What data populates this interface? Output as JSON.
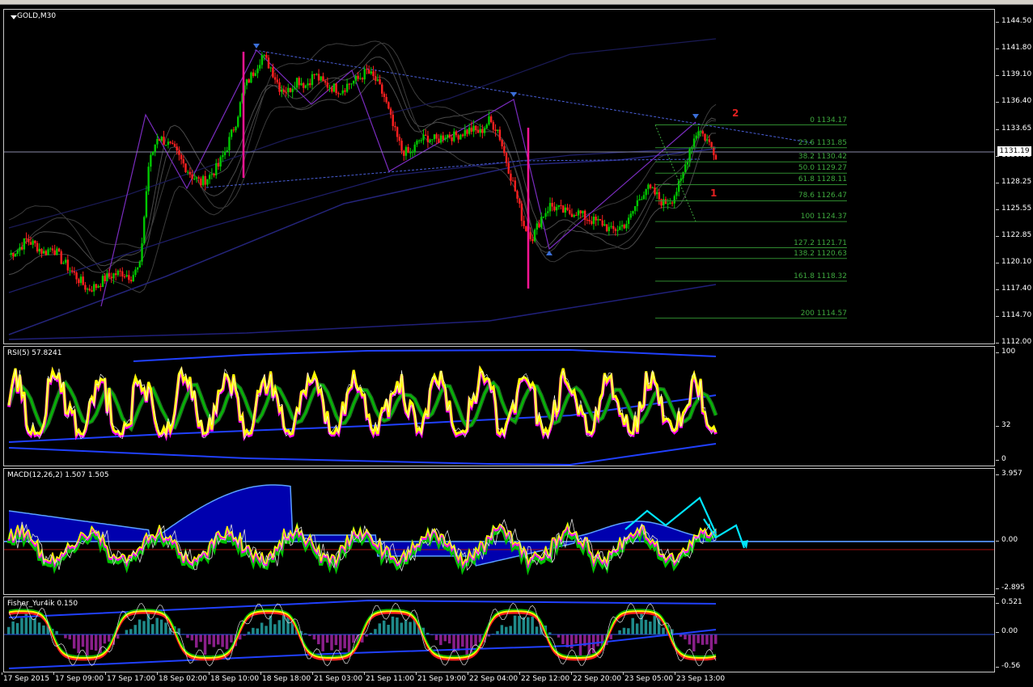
{
  "window": {
    "symbol_label": "GOLD,M30",
    "current_price": "1131.19"
  },
  "colors": {
    "bull_candle": "#00c800",
    "bear_candle": "#ff2020",
    "grid_line": "#c8c8c8",
    "rsi_main": "#ffff00",
    "rsi_shadow": "#ff00ff",
    "signal_green": "#00c000",
    "band_blue": "#2040ff",
    "macd_hist": "#0000cc",
    "arrow_cyan": "#00e5ff",
    "fib_text": "#3ea83e",
    "wave_label": "#e02020"
  },
  "price_scale": [
    "1144.50",
    "1141.80",
    "1139.10",
    "1136.40",
    "1133.65",
    "1130.95",
    "1128.25",
    "1125.55",
    "1122.85",
    "1120.10",
    "1117.40",
    "1114.70",
    "1112.00"
  ],
  "fibonacci": [
    {
      "label": "0  1134.17",
      "price": 1134.17
    },
    {
      "label": "23.6  1131.85",
      "price": 1131.85
    },
    {
      "label": "38.2  1130.42",
      "price": 1130.42
    },
    {
      "label": "50.0  1129.27",
      "price": 1129.27
    },
    {
      "label": "61.8  1128.11",
      "price": 1128.11
    },
    {
      "label": "78.6  1126.47",
      "price": 1126.47
    },
    {
      "label": "100  1124.37",
      "price": 1124.37
    },
    {
      "label": "127.2  1121.71",
      "price": 1121.71
    },
    {
      "label": "138.2  1120.63",
      "price": 1120.63
    },
    {
      "label": "161.8  1118.32",
      "price": 1118.32
    },
    {
      "label": "200  1114.57",
      "price": 1114.57
    }
  ],
  "wave_labels": [
    "2",
    "1"
  ],
  "rsi": {
    "label": "RSI(5) 57.8241",
    "scale": [
      "100",
      "32",
      "0"
    ]
  },
  "macd": {
    "label": "MACD(12,26,2) 1.507 1.505",
    "scale": [
      "3.957",
      "0.00",
      "-2.895"
    ]
  },
  "fisher": {
    "label": "Fisher_Yur4ik 0.150",
    "scale": [
      "0.521",
      "0.00",
      "-0.56"
    ]
  },
  "time_axis": [
    "17 Sep 2015",
    "17 Sep 09:00",
    "17 Sep 17:00",
    "18 Sep 02:00",
    "18 Sep 10:00",
    "18 Sep 18:00",
    "21 Sep 03:00",
    "21 Sep 11:00",
    "21 Sep 19:00",
    "22 Sep 04:00",
    "22 Sep 12:00",
    "22 Sep 20:00",
    "23 Sep 05:00",
    "23 Sep 13:00"
  ],
  "price_series": [
    1121,
    1121.5,
    1122.5,
    1122,
    1121.2,
    1121.8,
    1120.5,
    1119.5,
    1118.5,
    1117.5,
    1117.8,
    1118.6,
    1119,
    1119.2,
    1118.8,
    1119.8,
    1130,
    1133,
    1132.4,
    1131.5,
    1130.2,
    1129,
    1128.3,
    1129,
    1130,
    1132,
    1134.5,
    1138,
    1139.5,
    1141.2,
    1140,
    1138,
    1137.6,
    1138.8,
    1138.2,
    1139.3,
    1138.4,
    1138,
    1137.7,
    1138.4,
    1138.8,
    1139.6,
    1138.7,
    1137,
    1134,
    1131.6,
    1131.2,
    1132.6,
    1132.9,
    1132.6,
    1133.2,
    1133,
    1133.4,
    1133.7,
    1133.4,
    1134.6,
    1133.7,
    1130.5,
    1127.5,
    1124,
    1122.8,
    1124.8,
    1126,
    1125.6,
    1125.2,
    1125.4,
    1124.8,
    1124.4,
    1124.2,
    1123.4,
    1123.8,
    1124.4,
    1126.4,
    1127.8,
    1127.2,
    1126.2,
    1126.7,
    1128.4,
    1131.8,
    1133.8,
    1132.6,
    1131.2
  ]
}
